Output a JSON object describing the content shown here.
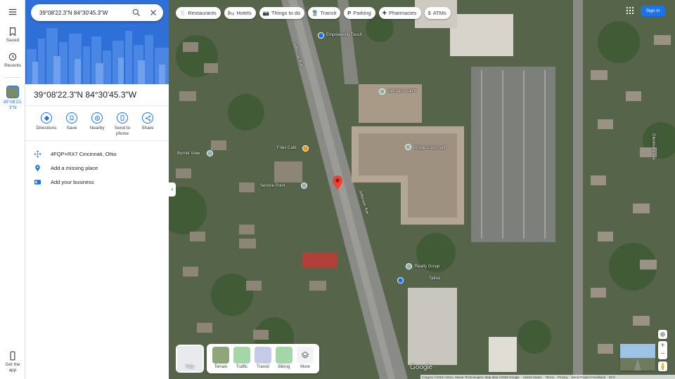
{
  "search": {
    "value": "39°08'22.3\"N 84°30'45.3\"W"
  },
  "rail": {
    "saved": "Saved",
    "recents": "Recents",
    "current_label": "39°08'22.3\"N",
    "get_app": "Get the app"
  },
  "place": {
    "title": "39°08'22.3\"N 84°30'45.3\"W"
  },
  "actions": [
    {
      "label": "Directions",
      "icon": "directions-icon"
    },
    {
      "label": "Save",
      "icon": "bookmark-icon"
    },
    {
      "label": "Nearby",
      "icon": "nearby-icon"
    },
    {
      "label": "Send to phone",
      "icon": "send-to-phone-icon"
    },
    {
      "label": "Share",
      "icon": "share-icon"
    }
  ],
  "info_rows": [
    {
      "text": "4FQP+RX7 Cincinnati, Ohio",
      "icon": "plus-code-icon"
    },
    {
      "text": "Add a missing place",
      "icon": "add-place-icon"
    },
    {
      "text": "Add your business",
      "icon": "business-icon"
    }
  ],
  "chips": [
    {
      "label": "Restaurants",
      "icon": "fork-knife-icon"
    },
    {
      "label": "Hotels",
      "icon": "bed-icon"
    },
    {
      "label": "Things to do",
      "icon": "camera-icon"
    },
    {
      "label": "Transit",
      "icon": "train-icon"
    },
    {
      "label": "Parking",
      "icon": "parking-icon"
    },
    {
      "label": "Pharmacies",
      "icon": "pharmacy-icon"
    },
    {
      "label": "ATMs",
      "icon": "atm-icon"
    }
  ],
  "sign_in": "Sign in",
  "map_labels": [
    "Empowering Touch",
    "Germann Janitt",
    "Bridge Cincinnati",
    "Burnet View",
    "Fries Café",
    "Service Point",
    "Realty Group",
    "Tattoo",
    "Jefferson Ave",
    "Jefferson Ave",
    "Glenmora Ave"
  ],
  "map_type_thumb": "Map",
  "layers": [
    "Terrain",
    "Traffic",
    "Transit",
    "Biking",
    "More"
  ],
  "google_logo": "Google",
  "footer": {
    "imagery": "Imagery ©2025 Airbus, Maxar Technologies, Map data ©2025 Google",
    "country": "United States",
    "terms": "Terms",
    "privacy": "Privacy",
    "feedback": "Send Product Feedback",
    "scale": "50 ft"
  },
  "colors": {
    "accent": "#1a73e8",
    "pin": "#ea4335"
  }
}
